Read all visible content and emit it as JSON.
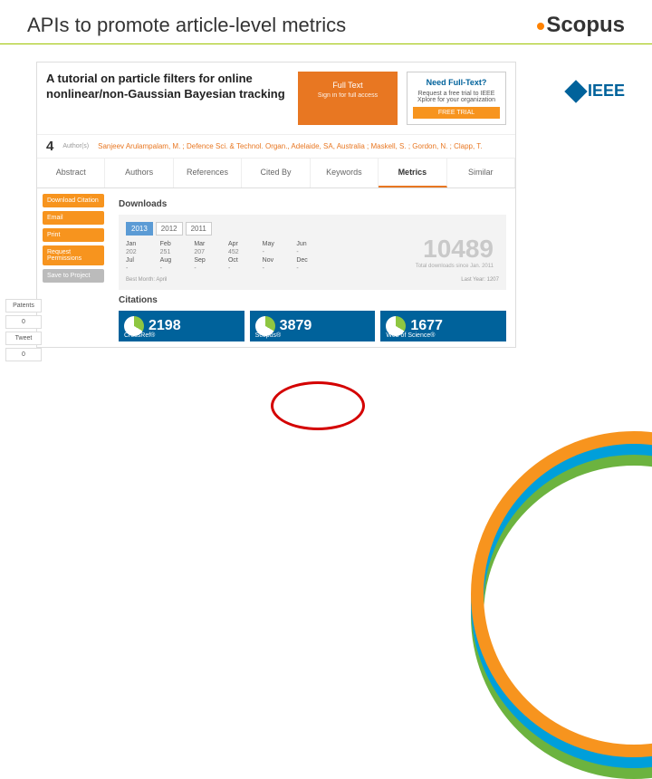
{
  "slide": {
    "title": "APIs to promote article-level metrics",
    "brand": "Scopus",
    "ieee": "IEEE"
  },
  "article": {
    "title": "A tutorial on particle filters for online nonlinear/non-Gaussian Bayesian tracking",
    "fulltext_btn": "Full Text",
    "fulltext_sub": "Sign in for full access",
    "need_title": "Need Full-Text?",
    "need_sub": "Request a free trial to IEEE Xplore for your organization",
    "need_btn": "FREE TRIAL",
    "author_count": "4",
    "author_label": "Author(s)",
    "authors": "Sanjeev Arulampalam, M. ; Defence Sci. & Technol. Organ., Adelaide, SA, Australia ; Maskell, S. ; Gordon, N. ; Clapp, T."
  },
  "tabs": [
    "Abstract",
    "Authors",
    "References",
    "Cited By",
    "Keywords",
    "Metrics",
    "Similar"
  ],
  "side": [
    "Download Citation",
    "Email",
    "Print",
    "Request Permissions",
    "Save to Project"
  ],
  "downloads": {
    "title": "Downloads",
    "years": [
      "2013",
      "2012",
      "2011"
    ],
    "months": [
      "Jan",
      "Feb",
      "Mar",
      "Apr",
      "May",
      "Jun",
      "Jul",
      "Aug",
      "Sep",
      "Oct",
      "Nov",
      "Dec"
    ],
    "values": [
      "202",
      "251",
      "207",
      "452",
      "-",
      "-",
      "-",
      "-",
      "-",
      "-",
      "-",
      "-"
    ],
    "big": "10489",
    "big_sub": "Total downloads since Jan. 2011",
    "note_left": "Best Month: April",
    "note_right": "Last Year: 1207"
  },
  "citations": {
    "title": "Citations",
    "items": [
      {
        "num": "2198",
        "src": "CrossRef®"
      },
      {
        "num": "3879",
        "src": "Scopus®"
      },
      {
        "num": "1677",
        "src": "Web of Science®"
      }
    ]
  },
  "widgets": {
    "patents": "Patents",
    "count0": "0",
    "tweet": "Tweet",
    "count1": "0"
  }
}
